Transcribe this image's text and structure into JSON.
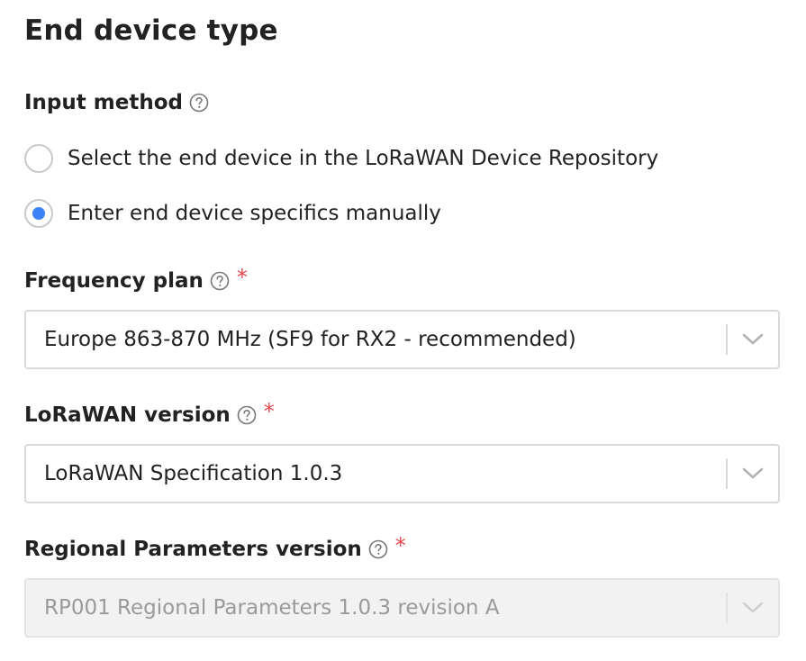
{
  "section": {
    "title": "End device type"
  },
  "input_method": {
    "label": "Input method",
    "help_icon": "question-circle-icon",
    "options": [
      {
        "label": "Select the end device in the LoRaWAN Device Repository",
        "checked": false
      },
      {
        "label": "Enter end device specifics manually",
        "checked": true
      }
    ]
  },
  "frequency_plan": {
    "label": "Frequency plan",
    "required_marker": "*",
    "help_icon": "question-circle-icon",
    "value": "Europe 863-870 MHz (SF9 for RX2 - recommended)"
  },
  "lorawan_version": {
    "label": "LoRaWAN version",
    "required_marker": "*",
    "help_icon": "question-circle-icon",
    "value": "LoRaWAN Specification 1.0.3"
  },
  "regional_parameters": {
    "label": "Regional Parameters version",
    "required_marker": "*",
    "help_icon": "question-circle-icon",
    "value": "RP001 Regional Parameters 1.0.3 revision A",
    "disabled": true
  },
  "colors": {
    "accent": "#3b82f6",
    "required": "#e5484d",
    "text": "#222222",
    "border": "#dadada",
    "disabled_bg": "#f2f2f2",
    "disabled_text": "#9a9a9a"
  }
}
